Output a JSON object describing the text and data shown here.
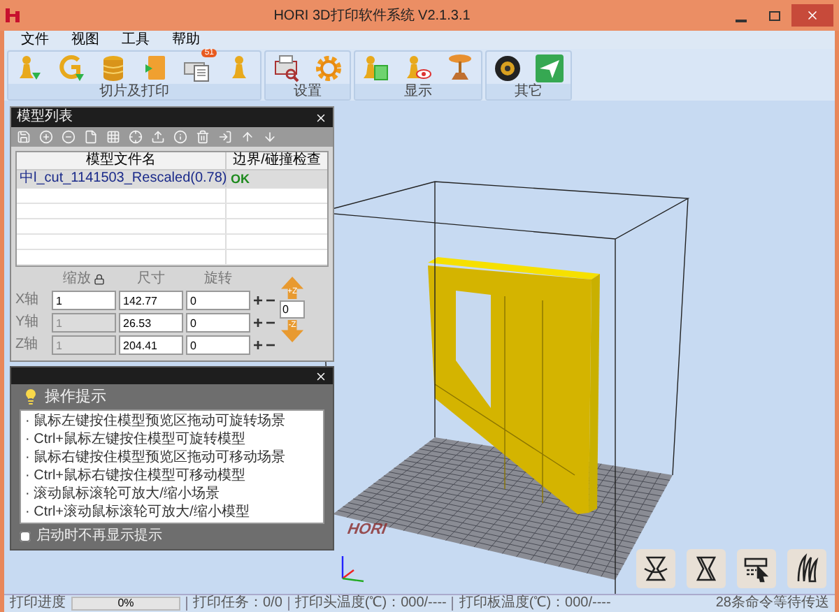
{
  "window": {
    "title": "HORI 3D打印软件系统 V2.1.3.1"
  },
  "menu": [
    "文件",
    "视图",
    "工具",
    "帮助"
  ],
  "ribbon": {
    "groups": [
      {
        "label": "切片及打印",
        "tools": [
          {
            "kind": "pawn-arrow"
          },
          {
            "kind": "ring-arrow"
          },
          {
            "kind": "coins"
          },
          {
            "kind": "book"
          },
          {
            "kind": "printer",
            "badge": "51"
          },
          {
            "kind": "pawn"
          }
        ]
      },
      {
        "label": "设置",
        "tools": [
          {
            "kind": "printer-magnifier"
          },
          {
            "kind": "gear"
          }
        ]
      },
      {
        "label": "显示",
        "tools": [
          {
            "kind": "pawn-sheet"
          },
          {
            "kind": "pawn-eye"
          },
          {
            "kind": "lamp"
          }
        ]
      },
      {
        "label": "其它",
        "tools": [
          {
            "kind": "lens"
          },
          {
            "kind": "plane"
          }
        ]
      }
    ]
  },
  "model_panel": {
    "title": "模型列表",
    "columns": [
      "模型文件名",
      "边界/碰撞检查"
    ],
    "rows": [
      {
        "name": "中l_cut_1141503_Rescaled(0.78)",
        "check": "OK",
        "selected": true
      }
    ],
    "transform": {
      "headings": [
        "缩放",
        "尺寸",
        "旋转"
      ],
      "increase": "+",
      "decrease": "−",
      "axes": [
        {
          "label": "X轴",
          "scale": "1",
          "scale_disabled": false,
          "size": "142.77",
          "rotate": "0"
        },
        {
          "label": "Y轴",
          "scale": "1",
          "scale_disabled": true,
          "size": "26.53",
          "rotate": "0"
        },
        {
          "label": "Z轴",
          "scale": "1",
          "scale_disabled": true,
          "size": "204.41",
          "rotate": "0"
        }
      ],
      "move_up": "+Z",
      "move_value": "0",
      "move_down": "-Z"
    }
  },
  "tips_panel": {
    "title": "操作提示",
    "items": [
      "· 鼠标左键按住模型预览区拖动可旋转场景",
      "· Ctrl+鼠标左键按住模型可旋转模型",
      "· 鼠标右键按住模型预览区拖动可移动场景",
      "· Ctrl+鼠标右键按住模型可移动模型",
      "· 滚动鼠标滚轮可放大/缩小场景",
      "· Ctrl+滚动鼠标滚轮可放大/缩小模型"
    ],
    "dont_show": {
      "label": "启动时不再显示提示",
      "checked": false
    }
  },
  "scene": {
    "platform_logo": "HORI"
  },
  "view_buttons": [
    {
      "kind": "rotate"
    },
    {
      "kind": "twist"
    },
    {
      "kind": "select"
    },
    {
      "kind": "layers"
    }
  ],
  "status_bar": {
    "progress_label": "打印进度",
    "progress": {
      "level": 0,
      "reading": "0%"
    },
    "job": "打印任务：0/0",
    "head_temp": "打印头温度(℃)：000/----",
    "bed_temp": "打印板温度(℃)：000/----",
    "queue": "28条命令等待传送"
  }
}
